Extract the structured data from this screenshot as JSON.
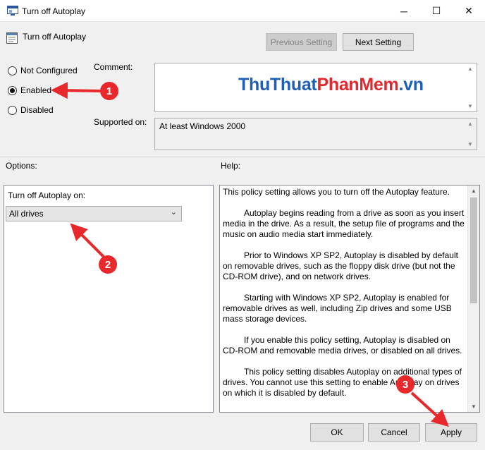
{
  "window": {
    "title": "Turn off Autoplay",
    "minimize_glyph": "─",
    "maximize_glyph": "☐",
    "close_glyph": "✕"
  },
  "header": {
    "policy_name": "Turn off Autoplay",
    "previous_label": "Previous Setting",
    "next_label": "Next Setting"
  },
  "state": {
    "options": [
      {
        "label": "Not Configured",
        "selected": false
      },
      {
        "label": "Enabled",
        "selected": true
      },
      {
        "label": "Disabled",
        "selected": false
      }
    ]
  },
  "comment": {
    "label": "Comment:",
    "value": ""
  },
  "supported": {
    "label": "Supported on:",
    "value": "At least Windows 2000"
  },
  "watermark": {
    "part1": "ThuThuat",
    "part2": "PhanMem",
    "part3": ".vn"
  },
  "options_section": {
    "label": "Options:",
    "field_label": "Turn off Autoplay on:",
    "selected_value": "All drives"
  },
  "help_section": {
    "label": "Help:",
    "paragraphs": [
      "This policy setting allows you to turn off the Autoplay feature.",
      "Autoplay begins reading from a drive as soon as you insert media in the drive. As a result, the setup file of programs and the music on audio media start immediately.",
      "Prior to Windows XP SP2, Autoplay is disabled by default on removable drives, such as the floppy disk drive (but not the CD-ROM drive), and on network drives.",
      "Starting with Windows XP SP2, Autoplay is enabled for removable drives as well, including Zip drives and some USB mass storage devices.",
      "If you enable this policy setting, Autoplay is disabled on CD-ROM and removable media drives, or disabled on all drives.",
      "This policy setting disables Autoplay on additional types of drives. You cannot use this setting to enable Autoplay on drives on which it is disabled by default."
    ]
  },
  "footer": {
    "ok_label": "OK",
    "cancel_label": "Cancel",
    "apply_label": "Apply"
  },
  "annotations": {
    "badge1": "1",
    "badge2": "2",
    "badge3": "3",
    "color": "#e8282b"
  },
  "colors": {
    "watermark_blue": "#1f5fb8",
    "watermark_red": "#e0282e"
  }
}
